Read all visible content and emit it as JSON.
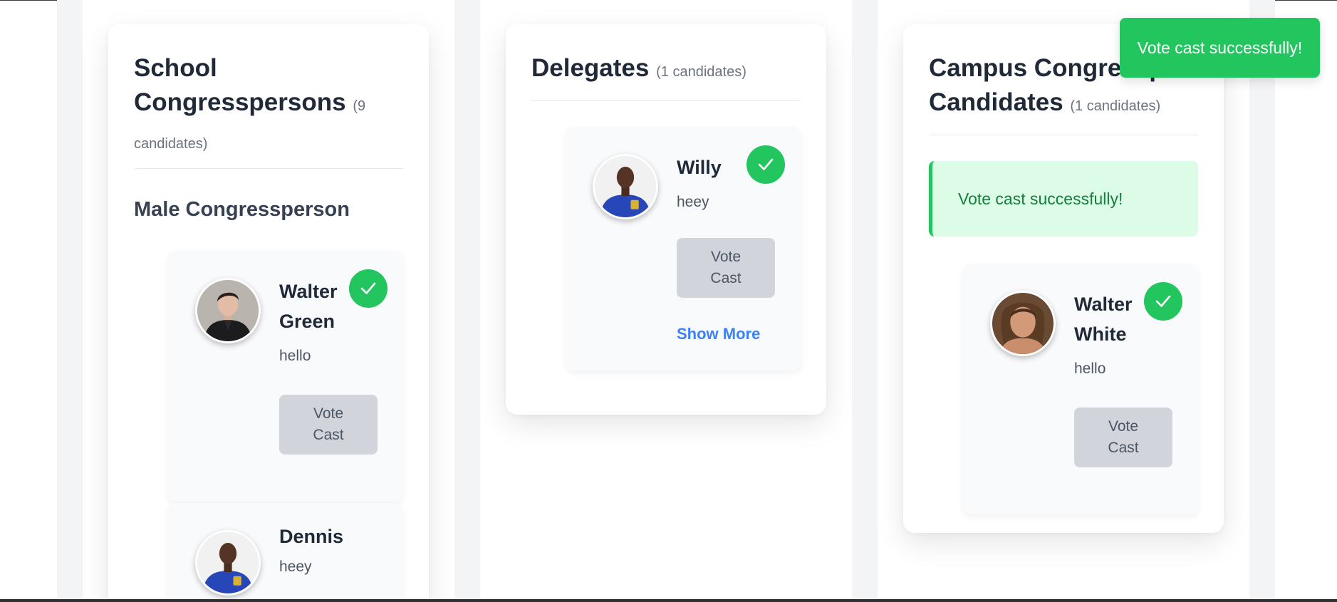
{
  "columns": [
    {
      "title": "School Congresspersons",
      "count_label": "(9 candidates)",
      "section": "Male Congressperson",
      "candidates": [
        {
          "name": "Walter Green",
          "description": "hello",
          "vote_label": "Vote Cast",
          "voted": true,
          "avatar": "photo-man-dark-jacket"
        },
        {
          "name": "Dennis",
          "description": "heey",
          "avatar": "photo-man-blue-shirt"
        }
      ]
    },
    {
      "title": "Delegates",
      "count_label": "(1 candidates)",
      "candidates": [
        {
          "name": "Willy",
          "description": "heey",
          "vote_label": "Vote Cast",
          "voted": true,
          "show_more_label": "Show More",
          "avatar": "photo-man-blue-shirt"
        }
      ]
    },
    {
      "title_line1": "Campus Congressperson",
      "title_line2": "Candidates",
      "count_label": "(1 candidates)",
      "alert": "Vote cast successfully!",
      "candidates": [
        {
          "name": "Walter White",
          "description": "hello",
          "vote_label": "Vote Cast",
          "voted": true,
          "avatar": "photo-man-long-hair"
        }
      ]
    }
  ],
  "toast": "Vote cast successfully!",
  "colors": {
    "success": "#22c55e",
    "success_bg": "#dcfce7",
    "link": "#3b82f6",
    "button_disabled": "#d1d5db"
  }
}
